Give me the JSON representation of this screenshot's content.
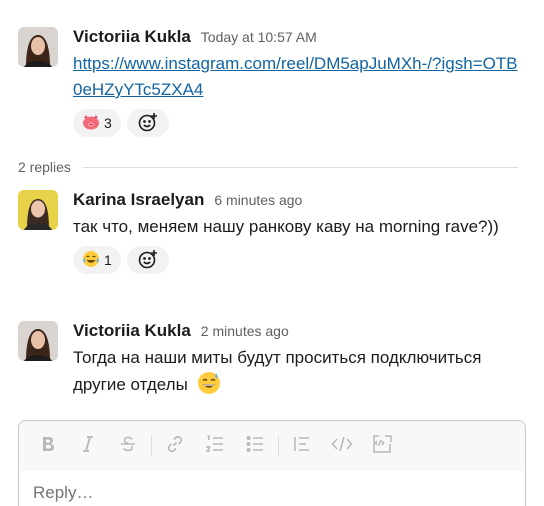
{
  "messages": [
    {
      "author": "Victoriia Kukla",
      "time": "Today at 10:57 AM",
      "link_text": "https://www.instagram.com/reel/DM5apJuMXh-/?igsh=OTB0eHZyYTc5ZXA4",
      "reactions": [
        {
          "emoji": "pig-face",
          "count": "3"
        }
      ]
    },
    {
      "author": "Karina Israelyan",
      "time": "6 minutes ago",
      "text": "так что, меняем нашу ранкову каву на morning rave?))",
      "reactions": [
        {
          "emoji": "joy",
          "count": "1"
        }
      ]
    },
    {
      "author": "Victoriia Kukla",
      "time": "2 minutes ago",
      "text": "Тогда на наши миты будут проситься подключиться другие отделы"
    }
  ],
  "thread": {
    "replies_label": "2 replies"
  },
  "composer": {
    "placeholder": "Reply…",
    "toolbar": [
      "bold",
      "italic",
      "strikethrough",
      "link",
      "ordered-list",
      "bulleted-list",
      "blockquote",
      "code",
      "code-block"
    ]
  },
  "colors": {
    "link": "#1264a3",
    "muted": "#616061",
    "reaction_bg": "#f2f2f2"
  }
}
